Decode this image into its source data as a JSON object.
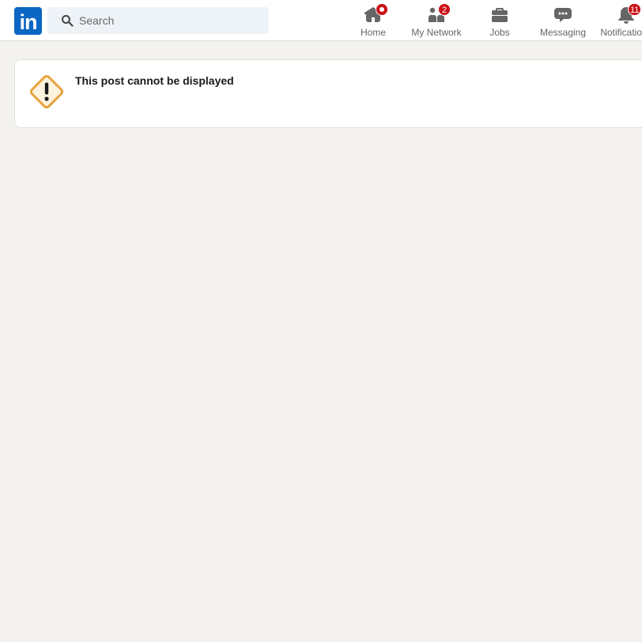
{
  "brand": {
    "logo_text": "in"
  },
  "search": {
    "placeholder": "Search",
    "value": ""
  },
  "nav": {
    "home": {
      "label": "Home",
      "has_dot": true
    },
    "network": {
      "label": "My Network",
      "badge": "2"
    },
    "jobs": {
      "label": "Jobs"
    },
    "messaging": {
      "label": "Messaging"
    },
    "notifications": {
      "label": "Notifications",
      "badge": "11"
    }
  },
  "notice": {
    "title": "This post cannot be displayed",
    "icon": "warning-icon"
  },
  "colors": {
    "brand": "#0a66c2",
    "badge": "#cc1016",
    "warning": "#e7a33e",
    "background": "#f3f2ef"
  }
}
